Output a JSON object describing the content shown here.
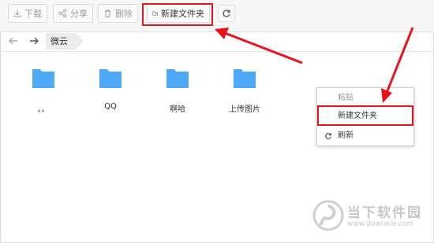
{
  "toolbar": {
    "download_label": "下载",
    "share_label": "分享",
    "delete_label": "删除",
    "new_folder_label": "新建文件夹"
  },
  "breadcrumb": {
    "current": "微云"
  },
  "files": [
    {
      "name": "。。",
      "icon": "folder-icon"
    },
    {
      "name": "QQ",
      "icon": "folder-icon"
    },
    {
      "name": "啊哈",
      "icon": "folder-icon"
    },
    {
      "name": "上传图片",
      "icon": "folder-icon"
    }
  ],
  "context_menu": {
    "paste_label": "粘贴",
    "new_folder_label": "新建文件夹",
    "refresh_label": "刷新"
  },
  "watermark": {
    "text": "当下软件园",
    "url": "www.downxia.com"
  },
  "colors": {
    "folder": "#4da8f5",
    "annotation": "#e8141c",
    "toolbar_bg": "#f7f7f7"
  }
}
